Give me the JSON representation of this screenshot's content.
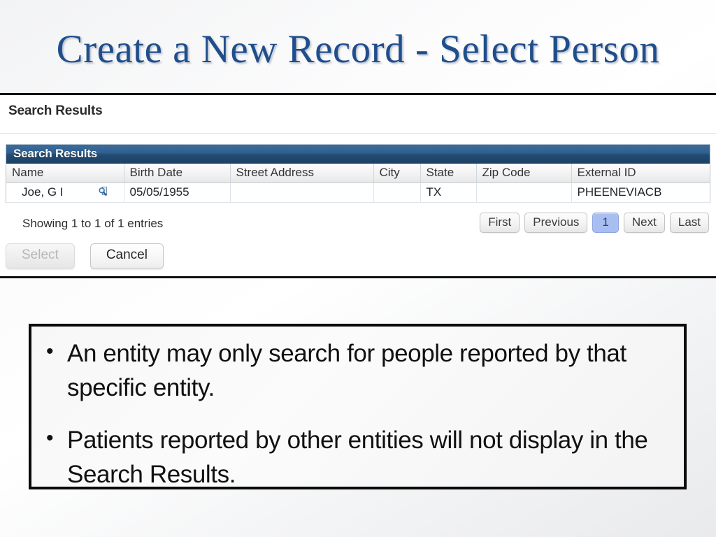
{
  "slide": {
    "title": "Create a New Record - Select Person",
    "title_color": "#1f4e8c"
  },
  "panel": {
    "caption": "Search Results",
    "grid_title": "Search Results",
    "header_color": "#2f5f8d",
    "table": {
      "columns": [
        "Name",
        "Birth Date",
        "Street Address",
        "City",
        "State",
        "Zip Code",
        "External ID"
      ],
      "rows": [
        {
          "name": "Joe, G I",
          "name_icon": "magnifier-document-icon",
          "birth_date": "05/05/1955",
          "street_address": "",
          "city": "",
          "state": "TX",
          "zip_code": "",
          "external_id": "PHEENEVIACB"
        }
      ]
    },
    "showing_text": "Showing 1 to 1 of 1 entries",
    "pagination": {
      "first_label": "First",
      "previous_label": "Previous",
      "current_page": "1",
      "next_label": "Next",
      "last_label": "Last",
      "active_color": "#a8bdf0"
    },
    "actions": {
      "select_label": "Select",
      "select_disabled": true,
      "cancel_label": "Cancel"
    }
  },
  "callout": {
    "bullet_glyph": "•",
    "bullets": [
      "An entity may only search for people reported by that specific entity.",
      "Patients reported by other entities will not display in the Search Results."
    ]
  }
}
